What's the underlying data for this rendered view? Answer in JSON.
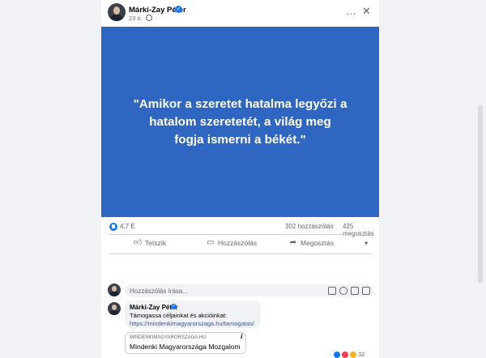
{
  "post": {
    "author": "Márki-Zay Péter",
    "verified_mark": "✓",
    "timestamp": "23 ó.",
    "quote": "\"Amikor a szeretet hatalma legyőzi a hatalom szeretetét, a világ meg fogja ismerni a békét.\"",
    "image_bg": "#2e66c2",
    "reactions_count": "4,7 E",
    "comments_count": "302 hozzászólás",
    "shares_count": "425 megosztás"
  },
  "header_icons": {
    "more": "…",
    "close": "✕"
  },
  "actions": {
    "like": "Tetszik",
    "comment": "Hozzászólás",
    "share": "Megosztás",
    "dropdown": "▾"
  },
  "comment_input": {
    "placeholder": "Hozzászólás írása..."
  },
  "comment": {
    "author": "Márki-Zay Péter",
    "verified_mark": "✓",
    "text": "Támogassa céljainkat és akcióinkat:",
    "link": "https://mindenkimagyarorszaga.hu/tamogatas/",
    "preview": {
      "domain": "MINDENKIMAGYARORSZAGA.HU",
      "title": "Mindenki Magyarországa Mozgalom"
    },
    "info_mark": "i",
    "reaction_count": "32"
  },
  "colors": {
    "accent": "#1877f2",
    "link": "#385898",
    "surface": "#f0f2f5"
  }
}
